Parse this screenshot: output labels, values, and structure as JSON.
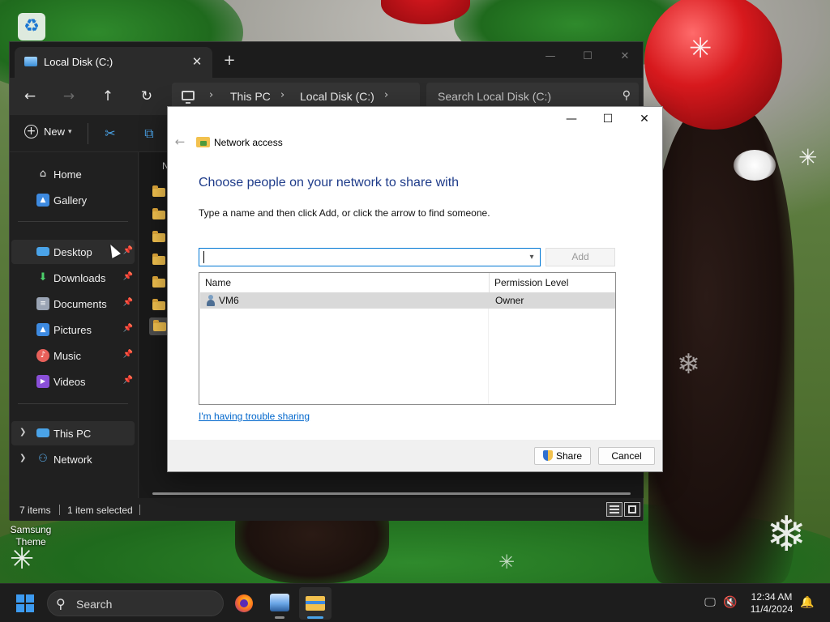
{
  "desktop": {
    "icon_label": "Samsung Theme"
  },
  "explorer": {
    "tab_title": "Local Disk (C:)",
    "new_tab": "+",
    "breadcrumb": [
      "This PC",
      "Local Disk (C:)"
    ],
    "search_placeholder": "Search Local Disk (C:)",
    "toolbar": {
      "new_label": "New"
    },
    "nav": {
      "home": "Home",
      "gallery": "Gallery",
      "desktop": "Desktop",
      "downloads": "Downloads",
      "documents": "Documents",
      "pictures": "Pictures",
      "music": "Music",
      "videos": "Videos",
      "this_pc": "This PC",
      "network": "Network"
    },
    "column_name_initial": "N",
    "status": {
      "items": "7 items",
      "selected": "1 item selected"
    }
  },
  "dialog": {
    "title": "Network access",
    "heading": "Choose people on your network to share with",
    "instruction": "Type a name and then click Add, or click the arrow to find someone.",
    "combo_value": "",
    "add_label": "Add",
    "columns": {
      "name": "Name",
      "permission": "Permission Level"
    },
    "rows": [
      {
        "name": "VM6",
        "permission": "Owner"
      }
    ],
    "trouble_link": "I'm having trouble sharing",
    "share_label": "Share",
    "cancel_label": "Cancel"
  },
  "taskbar": {
    "search_label": "Search",
    "time": "12:34 AM",
    "date": "11/4/2024"
  }
}
